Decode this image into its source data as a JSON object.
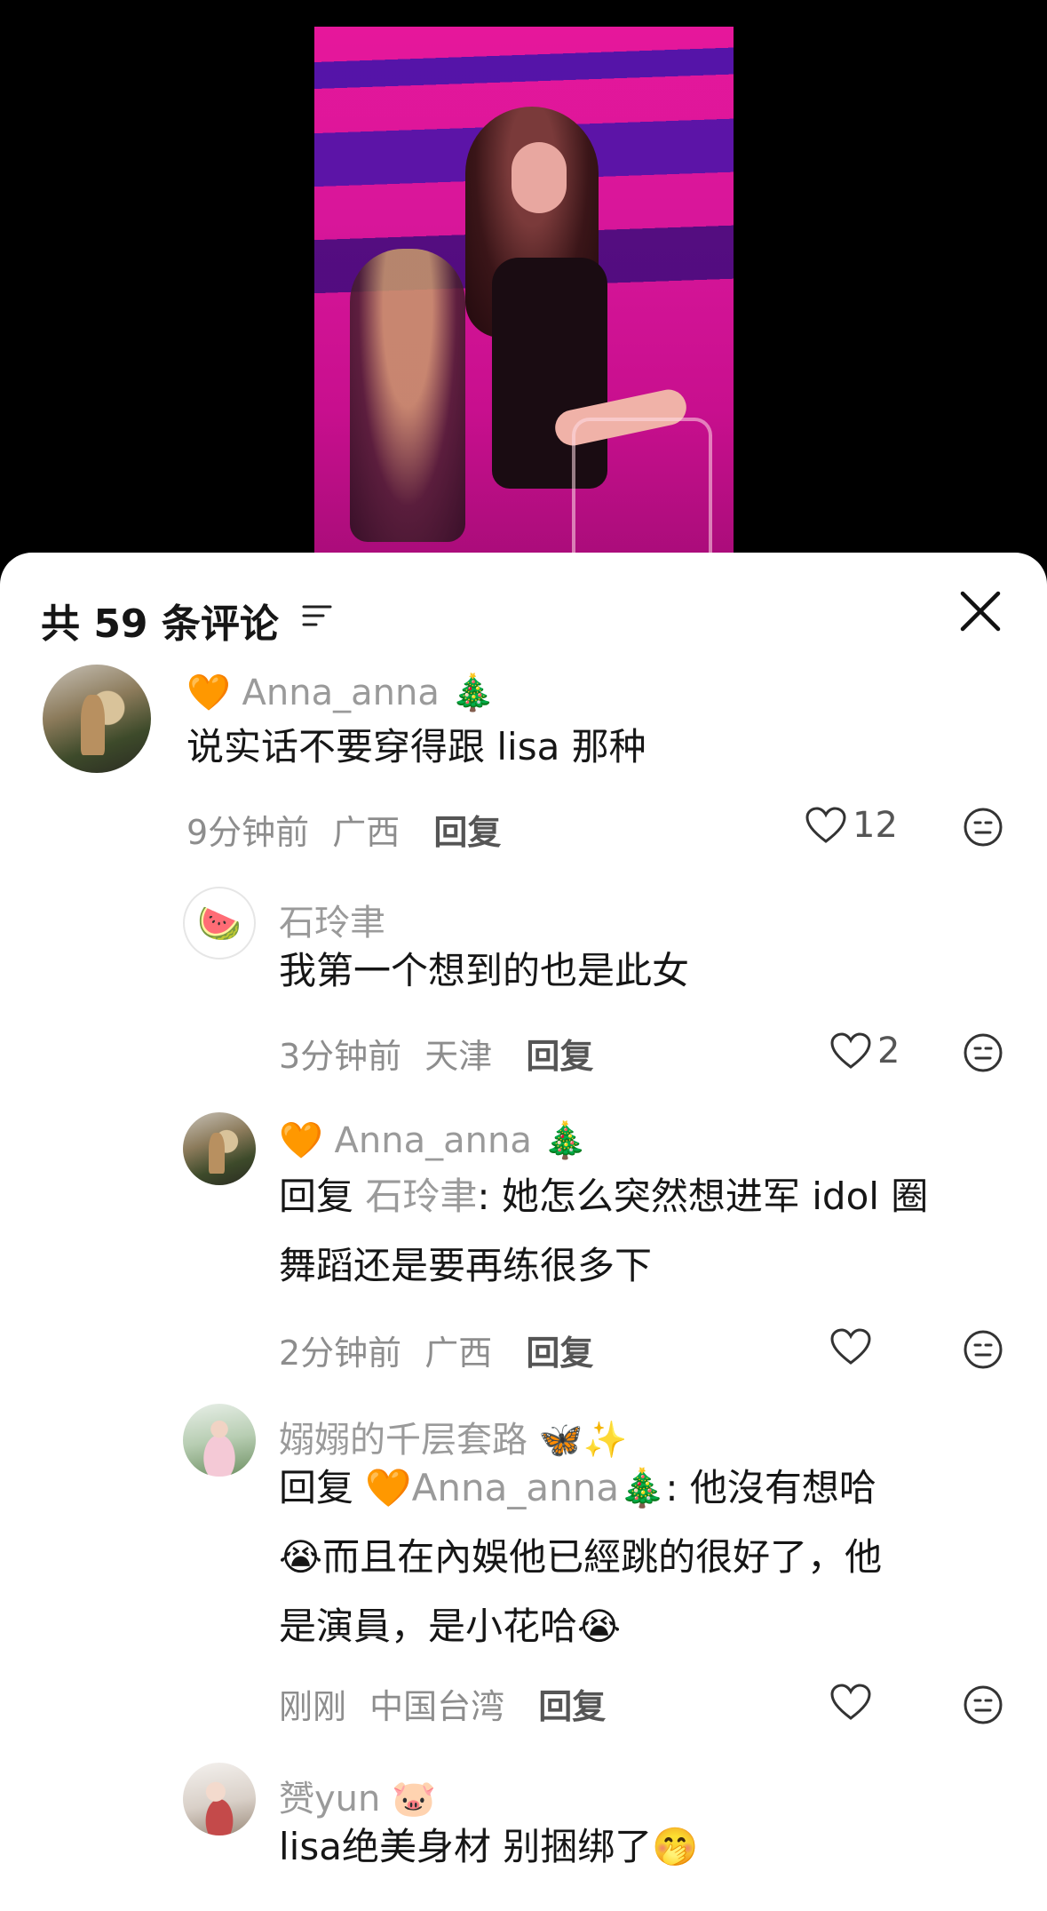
{
  "header": {
    "comment_count_label": "共 59 条评论"
  },
  "comments": [
    {
      "username": "Anna_anna",
      "name_prefix_emoji": "🧡",
      "name_suffix_emoji": "🎄",
      "text": "说实话不要穿得跟 lisa 那种",
      "time": "9分钟前",
      "location": "广西",
      "reply_label": "回复",
      "likes": "12"
    },
    {
      "username": "石玲聿",
      "avatar_emoji": "🍉",
      "text": "我第一个想到的也是此女",
      "time": "3分钟前",
      "location": "天津",
      "reply_label": "回复",
      "likes": "2"
    },
    {
      "username": "Anna_anna",
      "name_prefix_emoji": "🧡",
      "name_suffix_emoji": "🎄",
      "reply_prefix": "回复",
      "reply_to": "石玲聿",
      "text_line1": ": 她怎么突然想进军 idol 圈",
      "text_line2": "舞蹈还是要再练很多下",
      "time": "2分钟前",
      "location": "广西",
      "reply_label": "回复",
      "likes": ""
    },
    {
      "username": "嫋嫋的千层套路",
      "name_suffix_emoji": "🦋✨",
      "reply_prefix": "回复",
      "reply_to_emoji": "🧡",
      "reply_to": "Anna_anna",
      "reply_to_suffix": "🎄",
      "text_line1": ": 他沒有想哈",
      "text_line2_emoji": "😭",
      "text_line2": "而且在內娛他已經跳的很好了，他",
      "text_line3": "是演員，是小花哈",
      "text_line3_emoji": "😭",
      "time": "刚刚",
      "location": "中国台湾",
      "reply_label": "回复",
      "likes": ""
    },
    {
      "username": "赟yun",
      "name_suffix_emoji": "🐷",
      "text": "lisa绝美身材 别捆绑了",
      "text_suffix_emoji": "🤭"
    }
  ]
}
